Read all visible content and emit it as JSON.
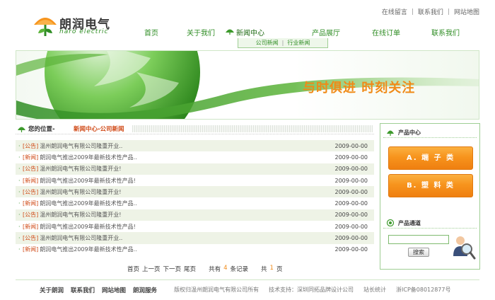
{
  "brand": {
    "name_cn": "朗润电气",
    "name_en": "naro electric"
  },
  "top_links": [
    "在线留言",
    "联系我们",
    "网站地图"
  ],
  "nav": {
    "home": "首页",
    "about": "关于我们",
    "news": "新闻中心",
    "products": "产品展厅",
    "order": "在线订单",
    "contact": "联系我们"
  },
  "subnav": {
    "company_news": "公司新闻",
    "industry_news": "行业新闻"
  },
  "banner": {
    "slogan": "与时俱进  时刻关注"
  },
  "breadcrumb": {
    "label": "您的位置-",
    "path": "新闻中心-公司新闻"
  },
  "news": [
    {
      "cat": "[公告]",
      "title": "温州朗润电气有限公司隆重开业..",
      "date": "2009-00-00"
    },
    {
      "cat": "[新闻]",
      "title": "朗润电气推出2009年最新技术性产品..",
      "date": "2009-00-00"
    },
    {
      "cat": "[公告]",
      "title": "温州朗润电气有限公司隆重开业!",
      "date": "2009-00-00"
    },
    {
      "cat": "[新闻]",
      "title": "朗润电气推出2009年最新技术性产品!",
      "date": "2009-00-00"
    },
    {
      "cat": "[公告]",
      "title": "温州朗润电气有限公司隆重开业!",
      "date": "2009-00-00"
    },
    {
      "cat": "[新闻]",
      "title": "朗润电气推出2009年最新技术性产品..",
      "date": "2009-00-00"
    },
    {
      "cat": "[公告]",
      "title": "温州朗润电气有限公司隆重开业!",
      "date": "2009-00-00"
    },
    {
      "cat": "[新闻]",
      "title": "朗润电气推出2009年最新技术性产品!",
      "date": "2009-00-00"
    },
    {
      "cat": "[公告]",
      "title": "温州朗润电气有限公司隆重开业..",
      "date": "2009-00-00"
    },
    {
      "cat": "[新闻]",
      "title": "朗润电气推出2009年最新技术性产品..",
      "date": "2009-00-00"
    }
  ],
  "pagination": {
    "first": "首页",
    "prev": "上一页",
    "next": "下一页",
    "last": "尾页",
    "total_prefix": "共有",
    "total_count": "4",
    "total_suffix": "条记录",
    "pages_prefix": "共",
    "pages_count": "1",
    "pages_suffix": "页"
  },
  "sidebar": {
    "products_title": "产品中心",
    "product_buttons": [
      "A. 端 子 类",
      "B. 塑 料 类"
    ],
    "channel_title": "产品通道",
    "search_value": "",
    "search_button": "搜索"
  },
  "footer": {
    "links": [
      "关于朗润",
      "联系我们",
      "网站地图",
      "朗润服务"
    ],
    "copyright": "版权归温州朗润电气有限公司所有",
    "support": "技术支持：深圳同拓品牌设计公司",
    "stats": "站长统计",
    "icp": "浙ICP备08012877号"
  },
  "colors": {
    "brand_green": "#2f8d24",
    "accent_orange": "#f7941d",
    "alert_red": "#d04a17"
  },
  "icons": {
    "logo": "umbrella-leaf-logo",
    "section": "leaf-icon",
    "search_person": "magnifier-person-icon"
  }
}
